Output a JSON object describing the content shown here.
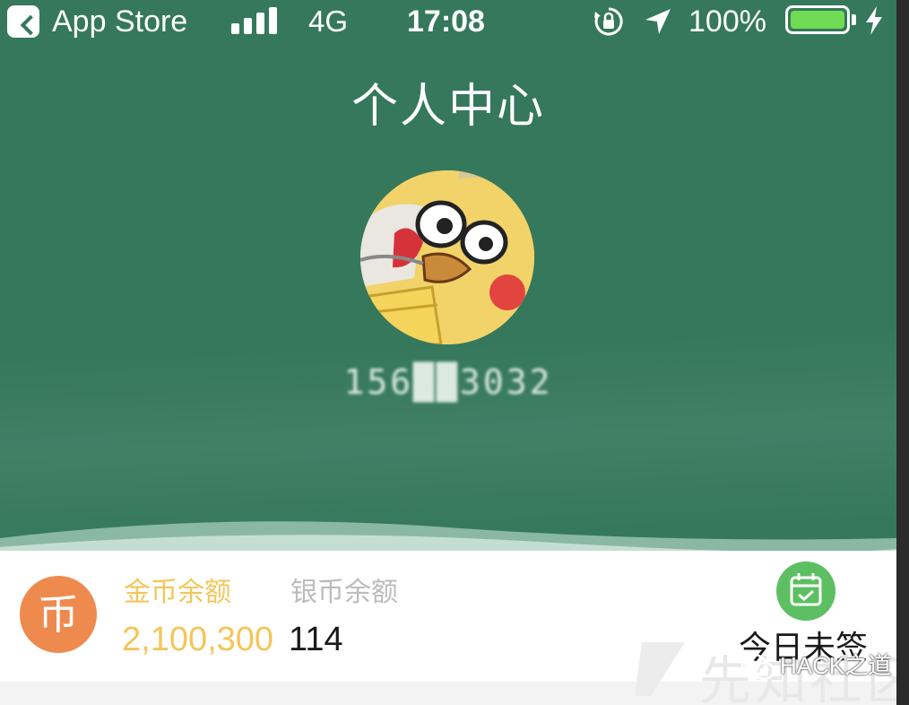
{
  "status_bar": {
    "back_app": "App Store",
    "network": "4G",
    "time": "17:08",
    "battery_percent": "100%",
    "icons": [
      "back-arrow-icon",
      "signal-bars-icon",
      "rotation-lock-icon",
      "location-arrow-icon",
      "battery-icon",
      "charging-bolt-icon"
    ]
  },
  "header": {
    "title": "个人中心",
    "phone_masked": "156██3032"
  },
  "balance": {
    "coin_icon_char": "币",
    "gold_label": "金币余额",
    "silver_label": "银币余额",
    "gold_value": "2,100,300",
    "silver_value": "114",
    "checkin_label": "今日未签"
  },
  "watermark": {
    "text": "HACK之道",
    "background_text": "先知社区"
  },
  "colors": {
    "header_green": "#35785c",
    "gold": "#f3c65a",
    "coin_orange": "#ef8a4f",
    "checkin_green": "#5cbf62",
    "battery_green": "#6fdc54"
  }
}
